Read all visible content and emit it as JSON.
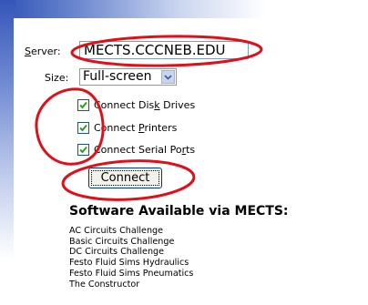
{
  "form": {
    "server_label_prefix": "S",
    "server_label_rest": "erver:",
    "server_value": "MECTS.CCCNEB.EDU",
    "size_label": "Size:",
    "size_value": "Full-screen",
    "options": [
      {
        "pre": "Connect Dis",
        "acc": "k",
        "post": " Drives",
        "checked": true
      },
      {
        "pre": "Connect ",
        "acc": "P",
        "post": "rinters",
        "checked": true
      },
      {
        "pre": "Connect Serial Po",
        "acc": "r",
        "post": "ts",
        "checked": true
      }
    ],
    "connect_label": "Connect"
  },
  "software": {
    "heading": "Software Available via MECTS:",
    "items": [
      "AC Circuits Challenge",
      "Basic Circuits Challenge",
      "DC Circuits Challenge",
      "Festo Fluid Sims Hydraulics",
      "Festo Fluid Sims Pneumatics",
      "The Constructor"
    ]
  },
  "colors": {
    "annotation_red": "#e0101a",
    "header_blue": "#2f52b6",
    "check_green": "#2aa21f"
  }
}
